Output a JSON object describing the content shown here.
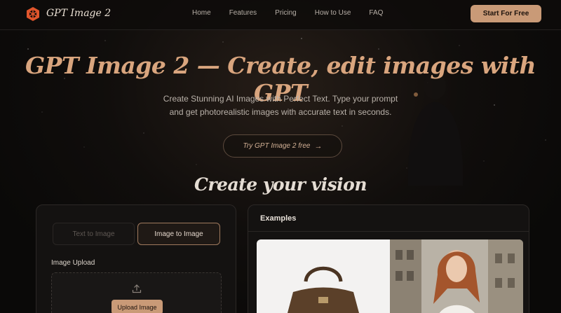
{
  "nav": {
    "brand": "GPT Image 2",
    "links": [
      "Home",
      "Features",
      "Pricing",
      "How to Use",
      "FAQ"
    ],
    "cta": "Start For Free"
  },
  "hero": {
    "title": "GPT Image 2 — Create, edit images with GPT",
    "subtitle_line1": "Create Stunning AI Images with Perfect Text. Type your prompt",
    "subtitle_line2": "and get photorealistic images with accurate text in seconds.",
    "button": "Try GPT Image 2 free",
    "button_icon": "arrow-right-icon"
  },
  "section": {
    "title": "Create your vision"
  },
  "generator": {
    "tabs": [
      "Text to Image",
      "Image to Image"
    ],
    "active_tab": "Image to Image",
    "upload_label": "Image Upload",
    "upload_button": "Upload Image",
    "upload_icon": "upload-icon"
  },
  "examples": {
    "label": "Examples"
  },
  "colors": {
    "accent": "#c99a77",
    "title": "#d9a57e",
    "background": "#0b0a09"
  }
}
